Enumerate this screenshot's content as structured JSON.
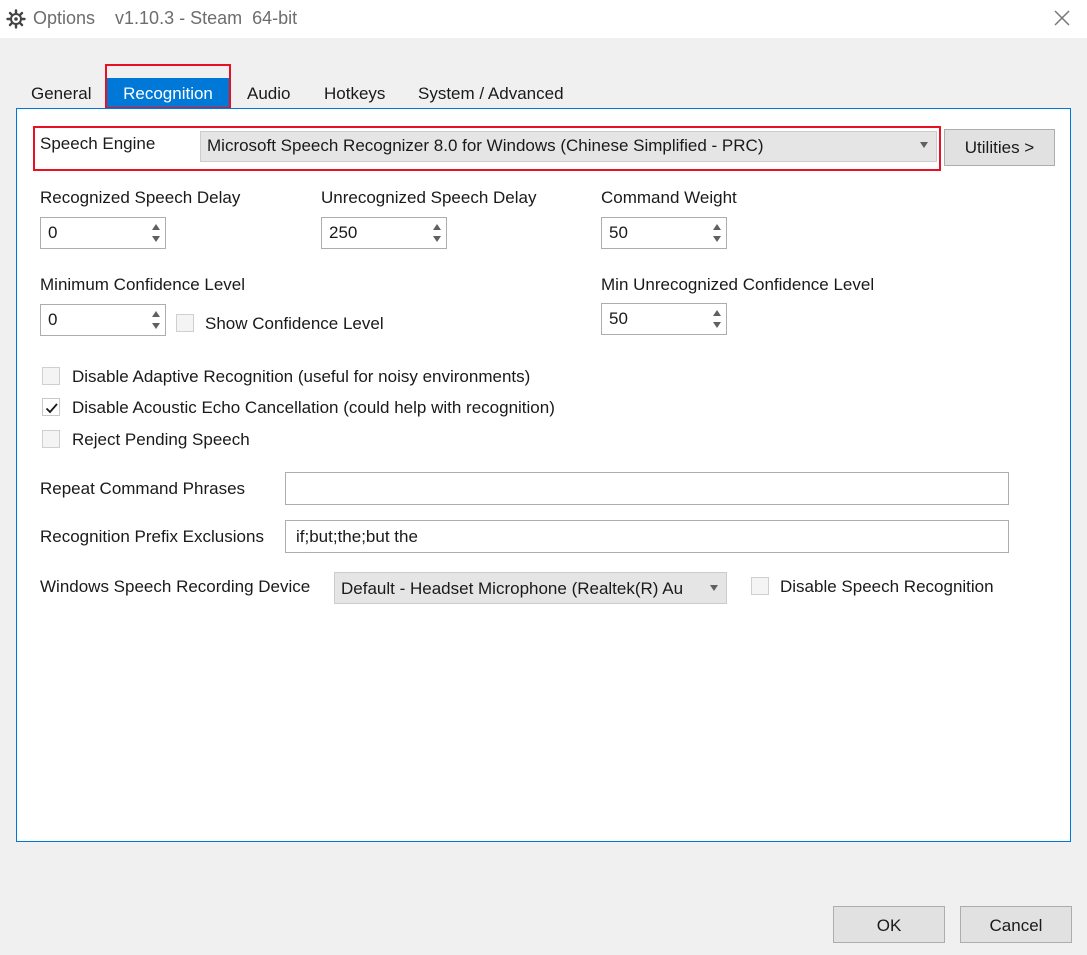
{
  "window": {
    "title": "Options    v1.10.3 - Steam  64-bit"
  },
  "tabs": [
    {
      "label": "General",
      "selected": false
    },
    {
      "label": "Recognition",
      "selected": true
    },
    {
      "label": "Audio",
      "selected": false
    },
    {
      "label": "Hotkeys",
      "selected": false
    },
    {
      "label": "System / Advanced",
      "selected": false
    }
  ],
  "recognition": {
    "speech_engine_label": "Speech Engine",
    "speech_engine_value": "Microsoft Speech Recognizer 8.0 for Windows (Chinese Simplified - PRC)",
    "utilities_button": "Utilities >",
    "recognized_delay_label": "Recognized Speech Delay",
    "recognized_delay_value": "0",
    "unrecognized_delay_label": "Unrecognized Speech Delay",
    "unrecognized_delay_value": "250",
    "command_weight_label": "Command Weight",
    "command_weight_value": "50",
    "min_confidence_label": "Minimum Confidence Level",
    "min_confidence_value": "0",
    "show_confidence_label": "Show Confidence Level",
    "show_confidence_checked": false,
    "min_unrecognized_label": "Min Unrecognized Confidence Level",
    "min_unrecognized_value": "50",
    "disable_adaptive_label": "Disable Adaptive Recognition (useful for noisy environments)",
    "disable_adaptive_checked": false,
    "disable_echo_label": "Disable Acoustic Echo Cancellation (could help with recognition)",
    "disable_echo_checked": true,
    "reject_pending_label": "Reject Pending Speech",
    "reject_pending_checked": false,
    "repeat_phrases_label": "Repeat Command Phrases",
    "repeat_phrases_value": "",
    "prefix_exclusions_label": "Recognition Prefix Exclusions",
    "prefix_exclusions_value": "if;but;the;but the",
    "recording_device_label": "Windows Speech Recording Device",
    "recording_device_value": "Default - Headset Microphone (Realtek(R) Au",
    "disable_speech_label": "Disable Speech Recognition",
    "disable_speech_checked": false
  },
  "footer": {
    "ok_label": "OK",
    "cancel_label": "Cancel"
  },
  "colors": {
    "accent": "#0078d7",
    "highlight_box": "#e81123",
    "dialog_bg": "#f0f0f0"
  },
  "icons": [
    "gear-icon",
    "close-icon",
    "combo-arrow-icon",
    "spin-up-icon",
    "spin-down-icon",
    "checkmark-icon"
  ]
}
